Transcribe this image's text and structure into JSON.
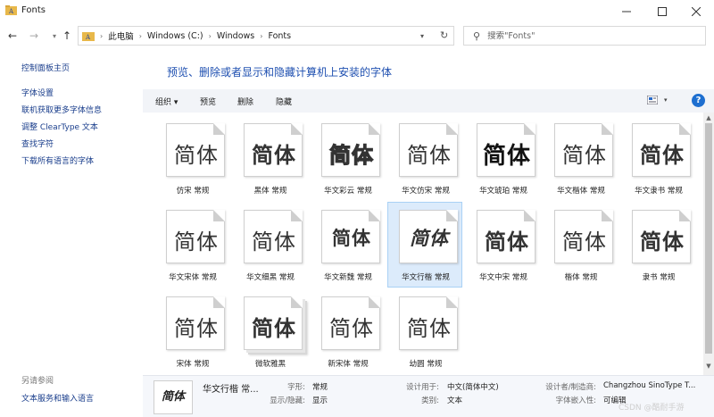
{
  "window": {
    "title": "Fonts"
  },
  "address": {
    "crumbs": [
      "此电脑",
      "Windows (C:)",
      "Windows",
      "Fonts"
    ],
    "search_placeholder": "搜索\"Fonts\""
  },
  "left_panel": {
    "home": "控制面板主页",
    "links": [
      "字体设置",
      "联机获取更多字体信息",
      "调整 ClearType 文本",
      "查找字符",
      "下载所有语言的字体"
    ],
    "see_also_title": "另请参阅",
    "see_also_link": "文本服务和输入语言"
  },
  "main": {
    "heading": "预览、删除或者显示和隐藏计算机上安装的字体",
    "toolbar": {
      "organize": "组织 ▾",
      "preview": "预览",
      "delete": "删除",
      "hide": "隐藏",
      "help": "?"
    }
  },
  "fonts": [
    {
      "label": "仿宋 常规",
      "sample": "简体",
      "style": "fangsong",
      "selected": false,
      "stacked": false
    },
    {
      "label": "黑体 常规",
      "sample": "简体",
      "style": "hei",
      "selected": false,
      "stacked": false
    },
    {
      "label": "华文彩云 常规",
      "sample": "简体",
      "style": "caiyun",
      "selected": false,
      "stacked": false
    },
    {
      "label": "华文仿宋 常规",
      "sample": "简体",
      "style": "wfs",
      "selected": false,
      "stacked": false
    },
    {
      "label": "华文琥珀 常规",
      "sample": "简体",
      "style": "hupo",
      "selected": false,
      "stacked": false
    },
    {
      "label": "华文楷体 常规",
      "sample": "简体",
      "style": "xihei",
      "selected": false,
      "stacked": false
    },
    {
      "label": "华文隶书 常规",
      "sample": "简体",
      "style": "lishu",
      "selected": false,
      "stacked": false
    },
    {
      "label": "华文宋体 常规",
      "sample": "简体",
      "style": "song",
      "selected": false,
      "stacked": false
    },
    {
      "label": "华文细黑 常规",
      "sample": "简体",
      "style": "xihei",
      "selected": false,
      "stacked": false
    },
    {
      "label": "华文新魏 常规",
      "sample": "简体",
      "style": "xinwei",
      "selected": false,
      "stacked": false
    },
    {
      "label": "华文行楷 常规",
      "sample": "简体",
      "style": "xingkai",
      "selected": true,
      "stacked": false
    },
    {
      "label": "华文中宋 常规",
      "sample": "简体",
      "style": "zhongsong",
      "selected": false,
      "stacked": false
    },
    {
      "label": "楷体 常规",
      "sample": "简体",
      "style": "fangsong",
      "selected": false,
      "stacked": false
    },
    {
      "label": "隶书 常规",
      "sample": "简体",
      "style": "hupo2",
      "selected": false,
      "stacked": false
    },
    {
      "label": "宋体 常规",
      "sample": "简体",
      "style": "song",
      "selected": false,
      "stacked": false
    },
    {
      "label": "微软雅黑",
      "sample": "简体",
      "style": "hei",
      "selected": false,
      "stacked": true
    },
    {
      "label": "新宋体 常规",
      "sample": "简体",
      "style": "song",
      "selected": false,
      "stacked": false
    },
    {
      "label": "幼圆 常规",
      "sample": "简体",
      "style": "xihei",
      "selected": false,
      "stacked": false
    }
  ],
  "details": {
    "thumb_sample": "简体",
    "name": "华文行楷 常...",
    "fields": [
      {
        "key": "字形:",
        "value": "常规"
      },
      {
        "key": "显示/隐藏:",
        "value": "显示"
      },
      {
        "key": "设计用于:",
        "value": "中文(简体中文)"
      },
      {
        "key": "类别:",
        "value": "文本"
      },
      {
        "key": "设计者/制造商:",
        "value": "Changzhou SinoType T..."
      },
      {
        "key": "字体嵌入性:",
        "value": "可编辑"
      }
    ]
  },
  "watermark": "CSDN @酷耐手游"
}
